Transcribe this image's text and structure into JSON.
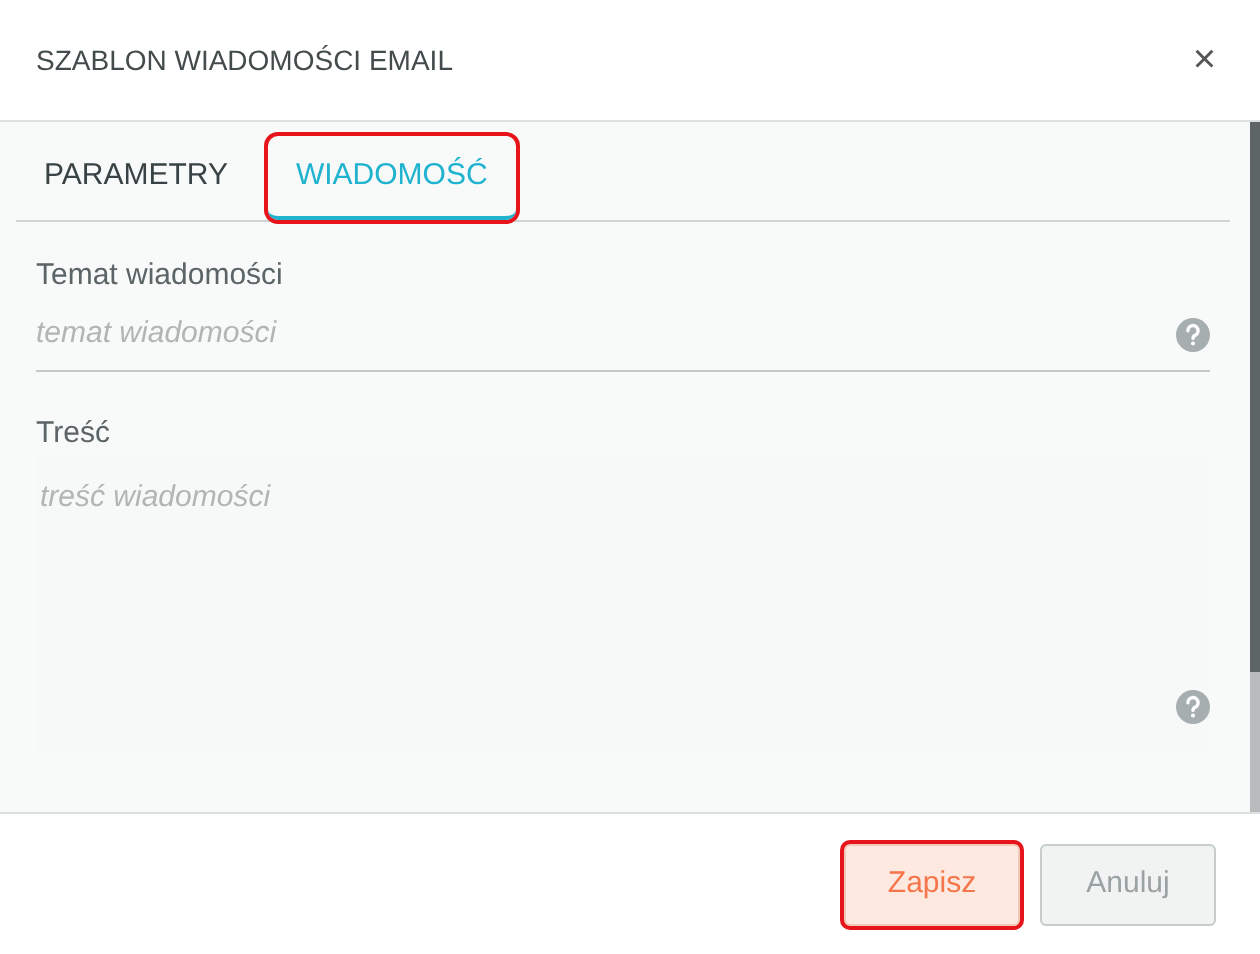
{
  "dialog": {
    "title": "SZABLON WIADOMOŚCI EMAIL",
    "close": "×"
  },
  "tabs": [
    {
      "label": "PARAMETRY",
      "selected": false,
      "highlighted": false
    },
    {
      "label": "WIADOMOŚĆ",
      "selected": true,
      "highlighted": true
    }
  ],
  "fields": [
    {
      "kind": "input",
      "label": "Temat wiadomości",
      "placeholder": "temat wiadomości"
    },
    {
      "kind": "textarea",
      "label": "Treść",
      "placeholder": "treść wiadomości"
    }
  ],
  "buttons": [
    {
      "label": "Zapisz",
      "kind": "primary",
      "highlighted": true
    },
    {
      "label": "Anuluj",
      "kind": "secondary",
      "highlighted": false
    }
  ]
}
